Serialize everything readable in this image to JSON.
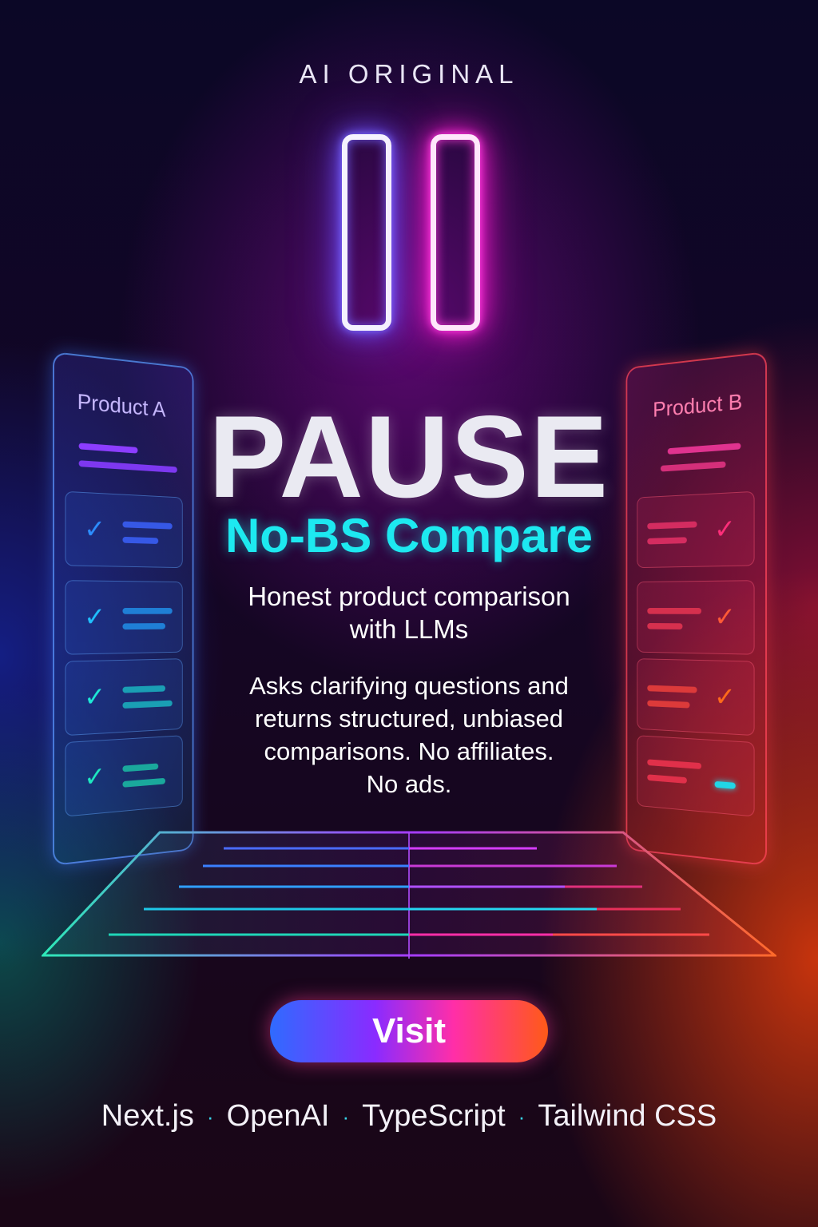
{
  "eyebrow": "AI ORIGINAL",
  "hero": {
    "title": "PAUSE",
    "subtitle": "No-BS Compare",
    "tagline_line1": "Honest product comparison",
    "tagline_line2": "with LLMs",
    "desc_line1": "Asks clarifying questions and",
    "desc_line2": "returns structured, unbiased",
    "desc_line3": "comparisons. No affiliates.",
    "desc_line4": "No ads."
  },
  "panels": {
    "a": {
      "title": "Product A",
      "rows": [
        "check",
        "check",
        "check",
        "check"
      ]
    },
    "b": {
      "title": "Product B",
      "rows": [
        "check",
        "check",
        "check",
        "dash"
      ]
    }
  },
  "cta": {
    "label": "Visit"
  },
  "stack": [
    "Next.js",
    "OpenAI",
    "TypeScript",
    "Tailwind CSS"
  ],
  "colors": {
    "accent_cyan": "#1de9f0",
    "accent_magenta": "#ff20d4",
    "accent_violet": "#6f55ff",
    "accent_orange": "#ff5a18"
  }
}
